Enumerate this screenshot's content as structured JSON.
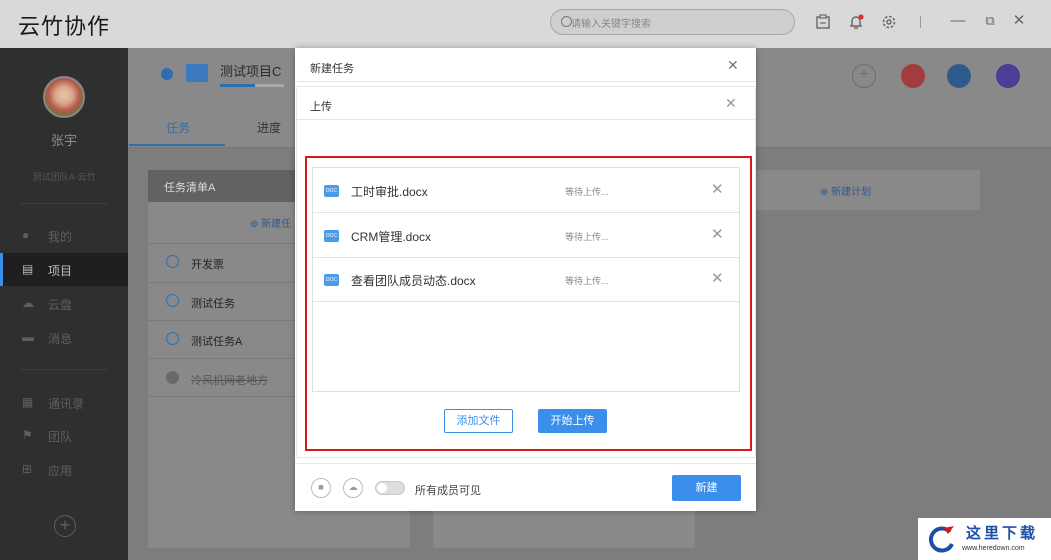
{
  "app": {
    "title": "云竹协作"
  },
  "search": {
    "placeholder": "请输入关键字搜索"
  },
  "window_controls": {
    "minimize": "—",
    "restore": "⧉",
    "close": "✕"
  },
  "user": {
    "name": "张宇",
    "team": "测试团队A-云竹"
  },
  "sidebar": {
    "items": [
      {
        "label": "我的",
        "icon": "person-icon"
      },
      {
        "label": "项目",
        "icon": "project-icon"
      },
      {
        "label": "云盘",
        "icon": "cloud-icon"
      },
      {
        "label": "消息",
        "icon": "message-icon"
      },
      {
        "label": "通讯录",
        "icon": "contacts-icon"
      },
      {
        "label": "团队",
        "icon": "flag-icon"
      },
      {
        "label": "应用",
        "icon": "apps-icon"
      }
    ]
  },
  "project": {
    "name": "测试项目C",
    "tabs": [
      "任务",
      "进度"
    ]
  },
  "task_list": {
    "title": "任务清单A",
    "new_task": "新建任",
    "tasks": [
      "开发票",
      "测试任务",
      "测试任务A",
      "冷风机网老地方"
    ],
    "new_plan": "新建计划"
  },
  "dialog_new": {
    "title": "新建任务",
    "close": "✕",
    "visibility_label": "所有成员可见",
    "create_button": "新建"
  },
  "dialog_upload": {
    "title": "上传",
    "close": "✕",
    "files": [
      {
        "name": "工时审批.docx",
        "status": "等待上传...",
        "remove": "✕"
      },
      {
        "name": "CRM管理.docx",
        "status": "等待上传...",
        "remove": "✕"
      },
      {
        "name": "查看团队成员动态.docx",
        "status": "等待上传...",
        "remove": "✕"
      }
    ],
    "add_file_button": "添加文件",
    "start_upload_button": "开始上传"
  },
  "watermark": {
    "title": "这里下载",
    "url": "www.heredown.com"
  },
  "colors": {
    "accent": "#3b8eea",
    "highlight_border": "#d9181e"
  }
}
